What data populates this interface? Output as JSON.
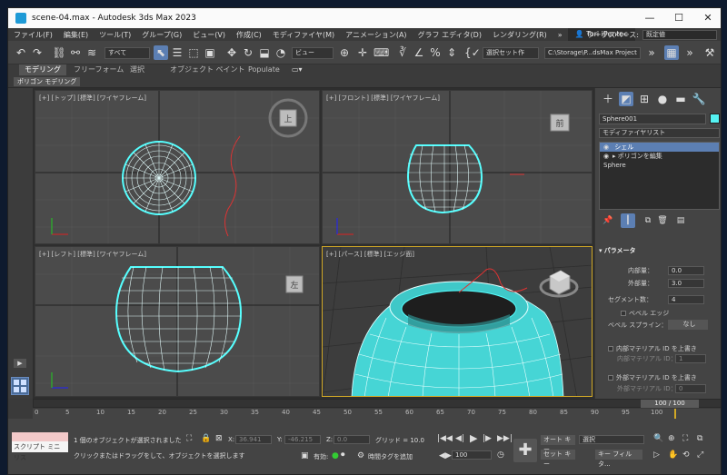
{
  "window": {
    "title": "scene-04.max - Autodesk 3ds Max 2023",
    "minimize": "—",
    "maximize": "☐",
    "close": "✕"
  },
  "menu": [
    "ファイル(F)",
    "編集(E)",
    "ツール(T)",
    "グループ(G)",
    "ビュー(V)",
    "作成(C)",
    "モディファイヤ(M)",
    "アニメーション(A)",
    "グラフ エディタ(D)",
    "レンダリング(R)",
    "»"
  ],
  "user": "Tori iPentec",
  "workspace": {
    "label": "ワークスペース:",
    "value": "既定値"
  },
  "toolbar": {
    "filter": "すべて",
    "view": "ビュー",
    "selection_set": "選択セット作",
    "path": "C:\\Storage\\P...dsMax Project"
  },
  "ribbon": {
    "tabs": [
      "モデリング",
      "フリーフォーム",
      "選択",
      "オブジェクト ペイント",
      "Populate"
    ],
    "active": "モデリング",
    "sub": "ポリゴン モデリング"
  },
  "viewports": {
    "top": "[+] [トップ] [標準] [ワイヤフレーム]",
    "front": "[+] [フロント] [標準] [ワイヤフレーム]",
    "left": "[+] [レフト] [標準] [ワイヤフレーム]",
    "persp": "[+] [パース] [標準] [エッジ面]",
    "cube_top": "上",
    "cube_front": "前",
    "cube_left": "左"
  },
  "command_panel": {
    "object_name": "Sphere001",
    "object_color": "#55f2f2",
    "modifier_list": "モディファイヤリスト",
    "stack": [
      {
        "label": "シェル",
        "selected": true
      },
      {
        "label": "ポリゴンを編集",
        "selected": false
      },
      {
        "label": "Sphere",
        "selected": false
      }
    ],
    "params": {
      "title": "パラメータ",
      "inner_label": "内部量：",
      "inner_value": "0.0",
      "outer_label": "外部量：",
      "outer_value": "3.0",
      "segments_label": "セグメント数：",
      "segments_value": "4",
      "bevel_edges": "ベベル エッジ",
      "bevel_spline_label": "ベベル スプライン：",
      "bevel_spline_value": "なし",
      "override_inner": "内部マテリアル ID を上書き",
      "inner_mat_id": "内部マテリアル ID：",
      "inner_mat_val": "1",
      "override_outer": "外部マテリアル ID を上書き",
      "outer_mat_id": "外部マテリアル ID：",
      "outer_mat_val": "0"
    }
  },
  "timeline": {
    "frame": "100 / 100",
    "ticks": [
      "0",
      "5",
      "10",
      "15",
      "20",
      "25",
      "30",
      "35",
      "40",
      "45",
      "50",
      "55",
      "60",
      "65",
      "70",
      "75",
      "80",
      "85",
      "90",
      "95",
      "100"
    ]
  },
  "status": {
    "script_label": "スクリプト ミニ リス",
    "selected": "1 個のオブジェクトが選択されました",
    "hint": "クリックまたはドラッグをして、オブジェクトを選択します",
    "x_label": "X:",
    "x_value": "36.941",
    "y_label": "Y:",
    "y_value": "-46.215",
    "z_label": "Z:",
    "z_value": "0.0",
    "grid": "グリッド = 10.0",
    "enabled": "有効:",
    "add_time_tag": "時間タグを追加",
    "frame_value": "100",
    "auto_key": "オート キー",
    "set_key": "セット キー",
    "selection": "選択",
    "key_filter": "キー フィルタ..."
  }
}
